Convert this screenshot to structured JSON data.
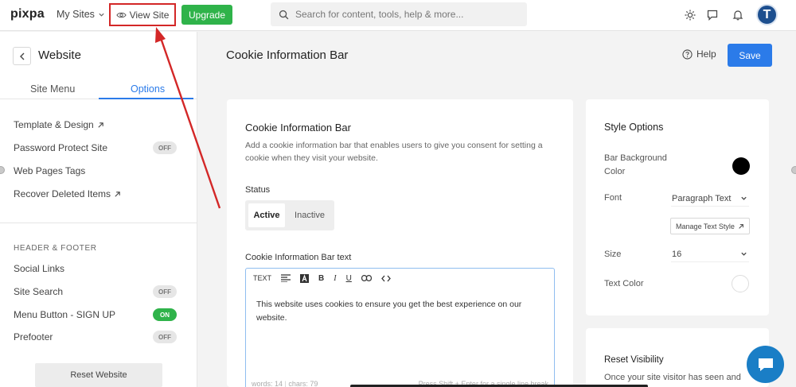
{
  "topbar": {
    "logo": "pixpa",
    "my_sites": "My Sites",
    "view_site": "View Site",
    "upgrade": "Upgrade",
    "search_placeholder": "Search for content, tools, help & more...",
    "avatar_initial": "T"
  },
  "sidebar": {
    "title": "Website",
    "tabs": [
      "Site Menu",
      "Options"
    ],
    "active_tab": "Options",
    "items": [
      {
        "label": "Template & Design",
        "external": true
      },
      {
        "label": "Password Protect Site",
        "toggle": "OFF"
      },
      {
        "label": "Web Pages Tags"
      },
      {
        "label": "Recover Deleted Items",
        "external": true
      }
    ],
    "section_label": "HEADER & FOOTER",
    "section_items": [
      {
        "label": "Social Links"
      },
      {
        "label": "Site Search",
        "toggle": "OFF"
      },
      {
        "label": "Menu Button - SIGN UP",
        "toggle": "ON"
      },
      {
        "label": "Prefooter",
        "toggle": "OFF"
      }
    ],
    "reset_button": "Reset Website"
  },
  "main": {
    "page_title": "Cookie Information Bar",
    "help": "Help",
    "save": "Save",
    "card": {
      "title": "Cookie Information Bar",
      "description": "Add a cookie information bar that enables users to give you consent for setting a cookie when they visit your website.",
      "status_label": "Status",
      "status_options": [
        "Active",
        "Inactive"
      ],
      "status_selected": "Active",
      "text_label": "Cookie Information Bar text",
      "toolbar": {
        "text": "TEXT",
        "bold": "B",
        "italic": "I",
        "underline": "U"
      },
      "editor_text": "This website uses cookies to ensure you get the best experience on our website.",
      "words": "words: 14",
      "chars": "chars: 79",
      "hint": "Press Shift + Enter for a single line break"
    },
    "style_options": {
      "title": "Style Options",
      "bar_background_label": "Bar Background Color",
      "bar_background_color": "#000000",
      "font_label": "Font",
      "font_value": "Paragraph Text",
      "manage_text_style": "Manage Text Style",
      "size_label": "Size",
      "size_value": "16",
      "text_color_label": "Text Color",
      "text_color": "#ffffff"
    },
    "reset_visibility": {
      "title": "Reset Visibility",
      "description": "Once your site visitor has seen and"
    }
  },
  "colors": {
    "accent": "#2b7be9",
    "upgrade_green": "#2fb34a",
    "annotation_red": "#d32727",
    "chat_blue": "#1a7ec6"
  }
}
